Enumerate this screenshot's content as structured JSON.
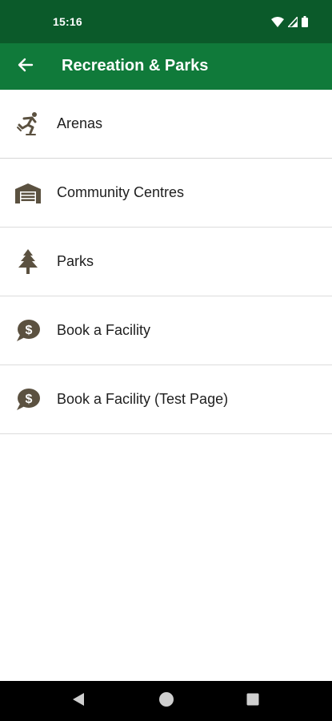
{
  "status_bar": {
    "time": "15:16",
    "icons": [
      "wifi-icon",
      "cell-signal-icon",
      "battery-icon"
    ]
  },
  "app_bar": {
    "back_icon": "arrow-left-icon",
    "title": "Recreation & Parks"
  },
  "menu": {
    "items": [
      {
        "label": "Arenas",
        "icon": "skater-icon"
      },
      {
        "label": "Community Centres",
        "icon": "building-icon"
      },
      {
        "label": "Parks",
        "icon": "tree-icon"
      },
      {
        "label": "Book a Facility",
        "icon": "dollar-speech-bubble-icon"
      },
      {
        "label": "Book a Facility (Test Page)",
        "icon": "dollar-speech-bubble-icon"
      }
    ]
  },
  "nav_bar": {
    "buttons": [
      "back-triangle-icon",
      "home-circle-icon",
      "recents-square-icon"
    ]
  },
  "colors": {
    "status_bar": "#0b5a2a",
    "app_bar": "#107a3a",
    "icon": "#5b5140",
    "text": "#1e1e1e"
  }
}
